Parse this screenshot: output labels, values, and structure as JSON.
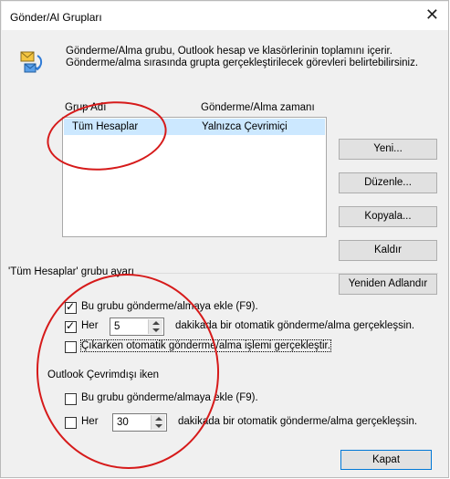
{
  "window": {
    "title": "Gönder/Al Grupları",
    "close_glyph": "✕"
  },
  "description": "Gönderme/Alma grubu, Outlook hesap ve klasörlerinin toplamını içerir. Gönderme/alma sırasında grupta gerçekleştirilecek görevleri belirtebilirsiniz.",
  "list": {
    "headers": {
      "group": "Grup Adı",
      "time": "Gönderme/Alma zamanı"
    },
    "rows": [
      {
        "group": "Tüm Hesaplar",
        "time": "Yalnızca Çevrimiçi"
      }
    ]
  },
  "buttons": {
    "new": "Yeni...",
    "edit": "Düzenle...",
    "copy": "Kopyala...",
    "remove": "Kaldır",
    "rename": "Yeniden Adlandır",
    "close": "Kapat"
  },
  "settings": {
    "group_title": "'Tüm Hesaplar' grubu ayarı",
    "online": {
      "include_label": "Bu grubu gönderme/almaya ekle (F9).",
      "include_checked": true,
      "every_label": "Her",
      "every_checked": true,
      "every_value": "5",
      "every_suffix": "dakikada bir otomatik gönderme/alma gerçekleşsin.",
      "on_exit_label": "Çıkarken otomatik gönderme/alma işlemi gerçekleştir.",
      "on_exit_checked": false
    },
    "offline_title": "Outlook Çevrimdışı iken",
    "offline": {
      "include_label": "Bu grubu gönderme/almaya ekle (F9).",
      "include_checked": false,
      "every_label": "Her",
      "every_checked": false,
      "every_value": "30",
      "every_suffix": "dakikada bir otomatik gönderme/alma gerçekleşsin."
    }
  },
  "colors": {
    "selection": "#cce8ff",
    "annotation": "#d61a1a",
    "focus_border": "#0078d7"
  },
  "icons": {
    "dialog_icon": "send-receive-groups-icon"
  }
}
